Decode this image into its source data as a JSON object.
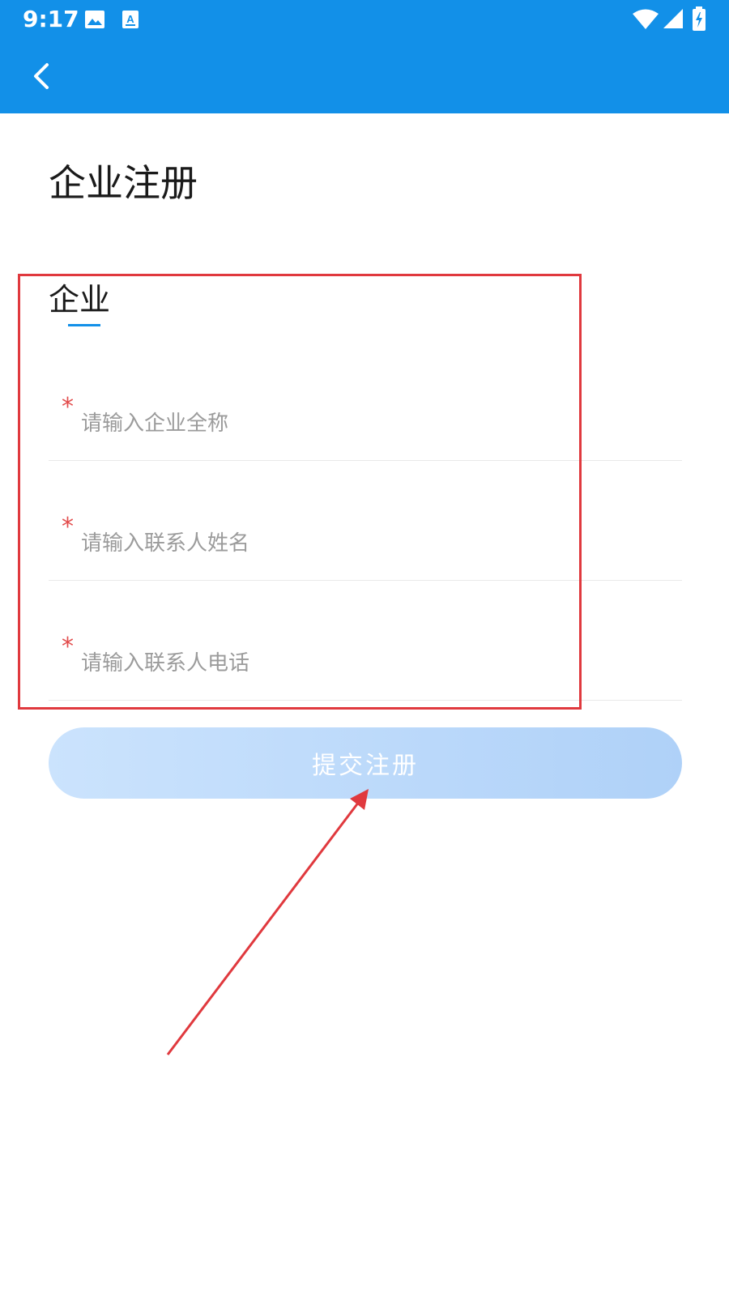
{
  "status_bar": {
    "time": "9:17",
    "left_icons": [
      "image-icon",
      "text-a-icon"
    ],
    "right_icons": [
      "wifi-icon",
      "signal-icon",
      "battery-charging-icon"
    ]
  },
  "app_bar": {
    "back_icon": "chevron-left-icon",
    "color": "#1290e8"
  },
  "page": {
    "title": "企业注册"
  },
  "tabs": [
    {
      "label": "企业",
      "active": true
    }
  ],
  "form": {
    "fields": [
      {
        "name": "company-name",
        "required_mark": "*",
        "placeholder": "请输入企业全称",
        "value": ""
      },
      {
        "name": "contact-name",
        "required_mark": "*",
        "placeholder": "请输入联系人姓名",
        "value": ""
      },
      {
        "name": "contact-phone",
        "required_mark": "*",
        "placeholder": "请输入联系人电话",
        "value": ""
      }
    ],
    "submit_label": "提交注册"
  },
  "colors": {
    "accent": "#1290e8",
    "required": "#e24c4c",
    "annotation": "#e0393e",
    "button_gradient_start": "#cbe3fd",
    "button_gradient_end": "#afd1f8"
  }
}
